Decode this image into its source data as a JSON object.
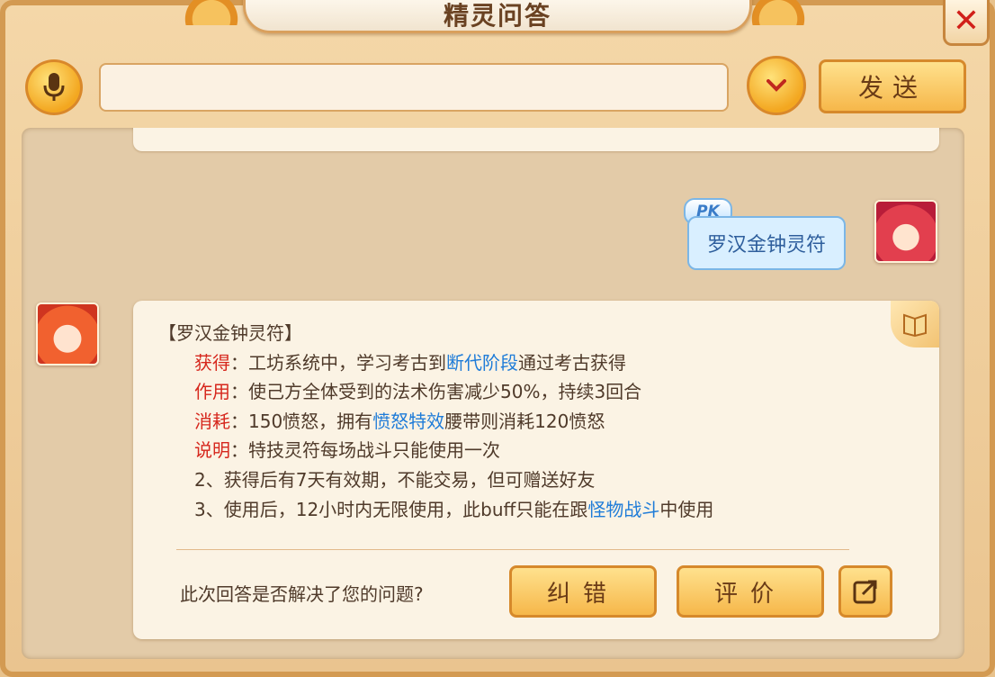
{
  "window": {
    "title": "精灵问答",
    "close_icon": "close-icon"
  },
  "input_bar": {
    "mic_icon": "microphone-icon",
    "input_value": "",
    "input_placeholder": "",
    "dropdown_icon": "chevron-down-icon",
    "send_label": "发送"
  },
  "chat": {
    "user_message": {
      "badge": "PK",
      "text": "罗汉金钟灵符"
    },
    "answer": {
      "title": "【罗汉金钟灵符】",
      "lines": [
        {
          "key": "获得",
          "pre": "：工坊系统中，学习考古到",
          "link": "断代阶段",
          "post": "通过考古获得"
        },
        {
          "key": "作用",
          "pre": "：使己方全体受到的法术伤害减少50%，持续3回合",
          "link": "",
          "post": ""
        },
        {
          "key": "消耗",
          "pre": "：150愤怒，拥有",
          "link": "愤怒特效",
          "post": "腰带则消耗120愤怒"
        },
        {
          "key": "说明",
          "pre": "：特技灵符每场战斗只能使用一次",
          "link": "",
          "post": ""
        }
      ],
      "note2": "2、获得后有7天有效期，不能交易，但可赠送好友",
      "note3_pre": "3、使用后，12小时内无限使用，此buff只能在跟",
      "note3_link": "怪物战斗",
      "note3_post": "中使用"
    },
    "feedback": {
      "question": "此次回答是否解决了您的问题?",
      "correct_label": "纠错",
      "rate_label": "评价",
      "share_icon": "share-icon"
    }
  },
  "colors": {
    "accent": "#f6b74a",
    "key_red": "#d6271d",
    "link_blue": "#1f7cd8"
  }
}
